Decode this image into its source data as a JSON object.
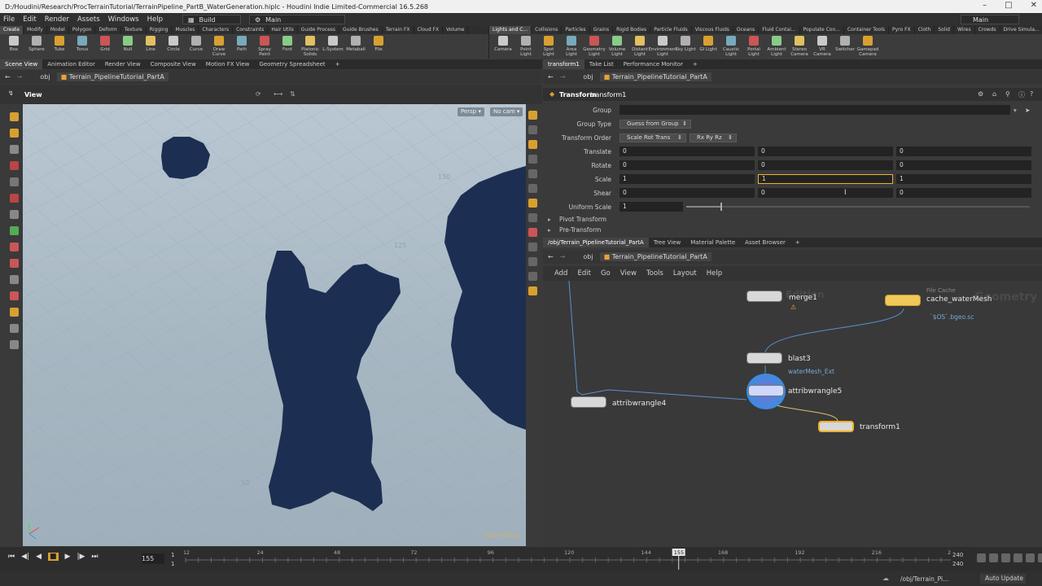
{
  "titlebar": {
    "title": "D:/Houdini/Research/ProcTerrainTutorial/TerrainPipeline_PartB_WaterGeneration.hiplc - Houdini Indie Limited-Commercial 16.5.268"
  },
  "menu": {
    "items": [
      "File",
      "Edit",
      "Render",
      "Assets",
      "Windows",
      "Help"
    ],
    "desktop": "Build",
    "main": "Main",
    "main_right": "Main"
  },
  "shelf_left": {
    "tabs": [
      "Create",
      "Modify",
      "Model",
      "Polygon",
      "Deform",
      "Texture",
      "Rigging",
      "Muscles",
      "Characters",
      "Constraints",
      "Hair Utils",
      "Guide Process",
      "Guide Brushes",
      "Terrain FX",
      "Cloud FX",
      "Volume"
    ],
    "tools": [
      "Box",
      "Sphere",
      "Tube",
      "Torus",
      "Grid",
      "Null",
      "Line",
      "Circle",
      "Curve",
      "Draw Curve",
      "Path",
      "Spray Paint",
      "Font",
      "Platonic Solids",
      "L-System",
      "Metaball",
      "File"
    ]
  },
  "shelf_right": {
    "tabs": [
      "Lights and C...",
      "Collisions",
      "Particles",
      "Grains",
      "Rigid Bodies",
      "Particle Fluids",
      "Viscous Fluids",
      "Oceans",
      "Fluid Contai...",
      "Populate Con...",
      "Container Tools",
      "Pyro FX",
      "Cloth",
      "Solid",
      "Wires",
      "Crowds",
      "Drive Simula..."
    ],
    "tools": [
      "Camera",
      "Point Light",
      "Spot Light",
      "Area Light",
      "Geometry Light",
      "Volume Light",
      "Distant Light",
      "Environment Light",
      "Sky Light",
      "GI Light",
      "Caustic Light",
      "Portal Light",
      "Ambient Light",
      "Stereo Camera",
      "VR Camera",
      "Switcher",
      "Gamepad Camera"
    ]
  },
  "left_tabs": [
    "Scene View",
    "Animation Editor",
    "Render View",
    "Composite View",
    "Motion FX View",
    "Geometry Spreadsheet"
  ],
  "left_path": {
    "context": "obj",
    "node": "Terrain_PipelineTutorial_PartA"
  },
  "viewport": {
    "label": "View",
    "persp": "Persp",
    "cam": "No cam",
    "grid_labels": [
      "150",
      "125",
      "50"
    ],
    "watermark": "Indie Edition"
  },
  "right_tabs": [
    "transform1",
    "Take List",
    "Performance Monitor"
  ],
  "right_path": {
    "context": "obj",
    "node": "Terrain_PipelineTutorial_PartA"
  },
  "params": {
    "node_type": "Transform",
    "node_name": "transform1",
    "group_label": "Group",
    "group_type_label": "Group Type",
    "group_type_value": "Guess from Group",
    "order_label": "Transform Order",
    "order_value": "Scale Rot Trans",
    "rot_order_value": "Rx Ry Rz",
    "translate": {
      "label": "Translate",
      "x": "0",
      "y": "0",
      "z": "0"
    },
    "rotate": {
      "label": "Rotate",
      "x": "0",
      "y": "0",
      "z": "0"
    },
    "scale": {
      "label": "Scale",
      "x": "1",
      "y": "1",
      "z": "1"
    },
    "shear": {
      "label": "Shear",
      "x": "0",
      "y": "0",
      "z": "0"
    },
    "uniform": {
      "label": "Uniform Scale",
      "value": "1",
      "slider_fraction": 0.1
    },
    "folders": [
      "Pivot Transform",
      "Pre-Transform"
    ]
  },
  "net_tabs": [
    "/obj/Terrain_PipelineTutorial_PartA",
    "Tree View",
    "Material Palette",
    "Asset Browser"
  ],
  "net_path": {
    "context": "obj",
    "node": "Terrain_PipelineTutorial_PartA"
  },
  "net_menu": [
    "Add",
    "Edit",
    "Go",
    "View",
    "Tools",
    "Layout",
    "Help"
  ],
  "network": {
    "watermark_left": "Edition",
    "watermark_right": "Geometry",
    "nodes": {
      "merge": "merge1",
      "cache_header": "File Cache",
      "cache": "cache_waterMesh",
      "cache_sub": "`$OS`.bgeo.sc",
      "blast": "blast3",
      "blast_sub": "waterMesh_Ext",
      "attrib5": "attribwrangle5",
      "attrib4": "attribwrangle4",
      "transform": "transform1"
    }
  },
  "timeline": {
    "current": "155",
    "start": "1",
    "start2": "1",
    "end": "240",
    "end2": "240",
    "ticks": [
      "1",
      "24",
      "48",
      "72",
      "96",
      "120",
      "144",
      "155",
      "168",
      "192",
      "216",
      "2"
    ],
    "range_start": 1,
    "range_end": 240
  },
  "status": {
    "path": "/obj/Terrain_Pi...",
    "update": "Auto Update"
  },
  "colors": {
    "accent": "#f0b02a",
    "water": "#1c2f52"
  }
}
